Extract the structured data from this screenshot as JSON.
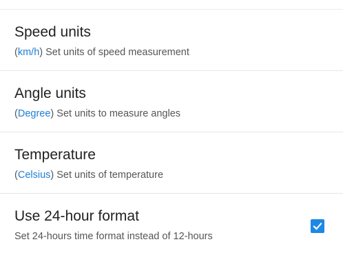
{
  "settings": [
    {
      "title": "Speed units",
      "value_prefix": "(",
      "value": "km/h",
      "value_suffix": ")",
      "description": " Set units of speed measurement"
    },
    {
      "title": "Angle units",
      "value_prefix": "(",
      "value": "Degree",
      "value_suffix": ")",
      "description": " Set units to measure angles"
    },
    {
      "title": "Temperature",
      "value_prefix": "(",
      "value": "Celsius",
      "value_suffix": ")",
      "description": " Set units of temperature"
    },
    {
      "title": "Use 24-hour format",
      "description": "Set 24-hours time format instead of 12-hours",
      "checked": true
    }
  ],
  "colors": {
    "accent": "#1e7ed6",
    "checkbox": "#1e88e5"
  },
  "icons": {
    "checkbox": "check-icon"
  }
}
